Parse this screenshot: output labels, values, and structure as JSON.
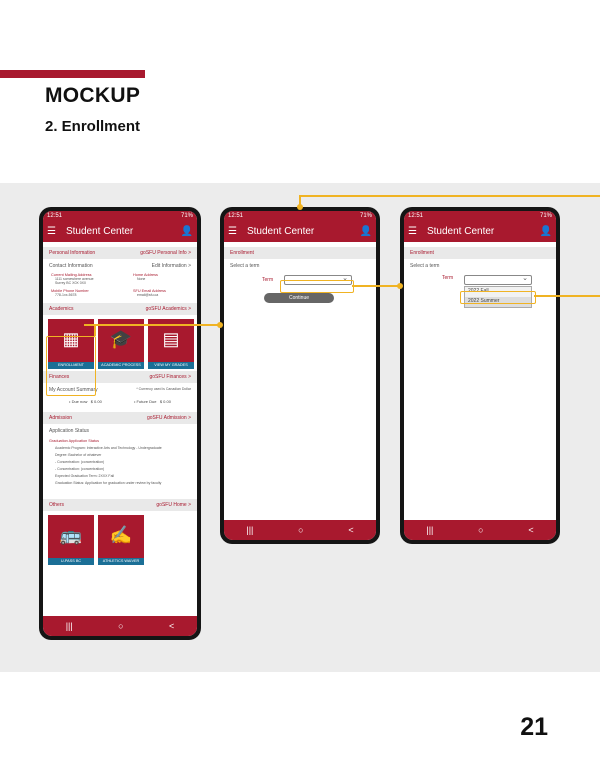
{
  "header": {
    "title": "MOCKUP",
    "subtitle": "2. Enrollment"
  },
  "page_number": "21",
  "accent_color": "#a8192e",
  "highlight_color": "#f0b323",
  "tile_caption_color": "#1b6f96",
  "status": {
    "time": "12:51",
    "battery": "71%"
  },
  "app_title": "Student Center",
  "nav": {
    "recents": "|||",
    "home": "○",
    "back": "<"
  },
  "screen1": {
    "personal": {
      "title": "Personal Information",
      "link": "goSFU Personal Info  >",
      "contact": "Contact Information",
      "edit": "Edit Information  >",
      "mailing_label": "Current Mailing Address",
      "mailing_v1": "1111 somewhere avenue",
      "mailing_v2": "Surrey BC X0X 0X0",
      "home_label": "Home Address",
      "home_v": "None",
      "phone_label": "Mobile Phone Number",
      "phone_v": "778-1xx-5678",
      "email_label": "SFU Email Address",
      "email_v": "email@sfu.ca"
    },
    "academics": {
      "title": "Academics",
      "link": "goSFU Academics  >",
      "tiles": [
        "ENROLLMENT",
        "ACADEMIC PROCESS",
        "VIEW MY GRADES"
      ]
    },
    "finances": {
      "title": "Finances",
      "link": "goSFU Finances  >",
      "summary": "My Account Summary",
      "currency": "* Currency used is Canadian Dollar",
      "due_now": "Due now",
      "due_now_v": "$ 0.00",
      "future": "Future Due",
      "future_v": "$ 0.00"
    },
    "admission": {
      "title": "Admission",
      "link": "goSFU Admission  >",
      "status": "Application Status",
      "grad": "Graduation Application Status",
      "program": "Academic Program: Interactive Arts and Technology - Undergraduate",
      "degree": "Degree: Bachelor of whatever",
      "conc1": "- Concentration: (concentration)",
      "conc2": "- Concentration: (concentration)",
      "exp_term": "Expected Graduation Term: 2XXX Fall",
      "grad_status": "Graduation Status: Application for graduation under review by faculty"
    },
    "others": {
      "title": "Others",
      "link": "goSFU Home  >",
      "tiles": [
        "U-PASS BC",
        "ATHLETICS WAIVER"
      ]
    }
  },
  "screen2": {
    "section": "Enrollment",
    "prompt": "Select a term",
    "term_label": "Term",
    "button": "Continue"
  },
  "screen3": {
    "section": "Enrollment",
    "prompt": "Select a term",
    "term_label": "Term",
    "options": [
      "2022 Fall",
      "2022 Summer"
    ]
  }
}
